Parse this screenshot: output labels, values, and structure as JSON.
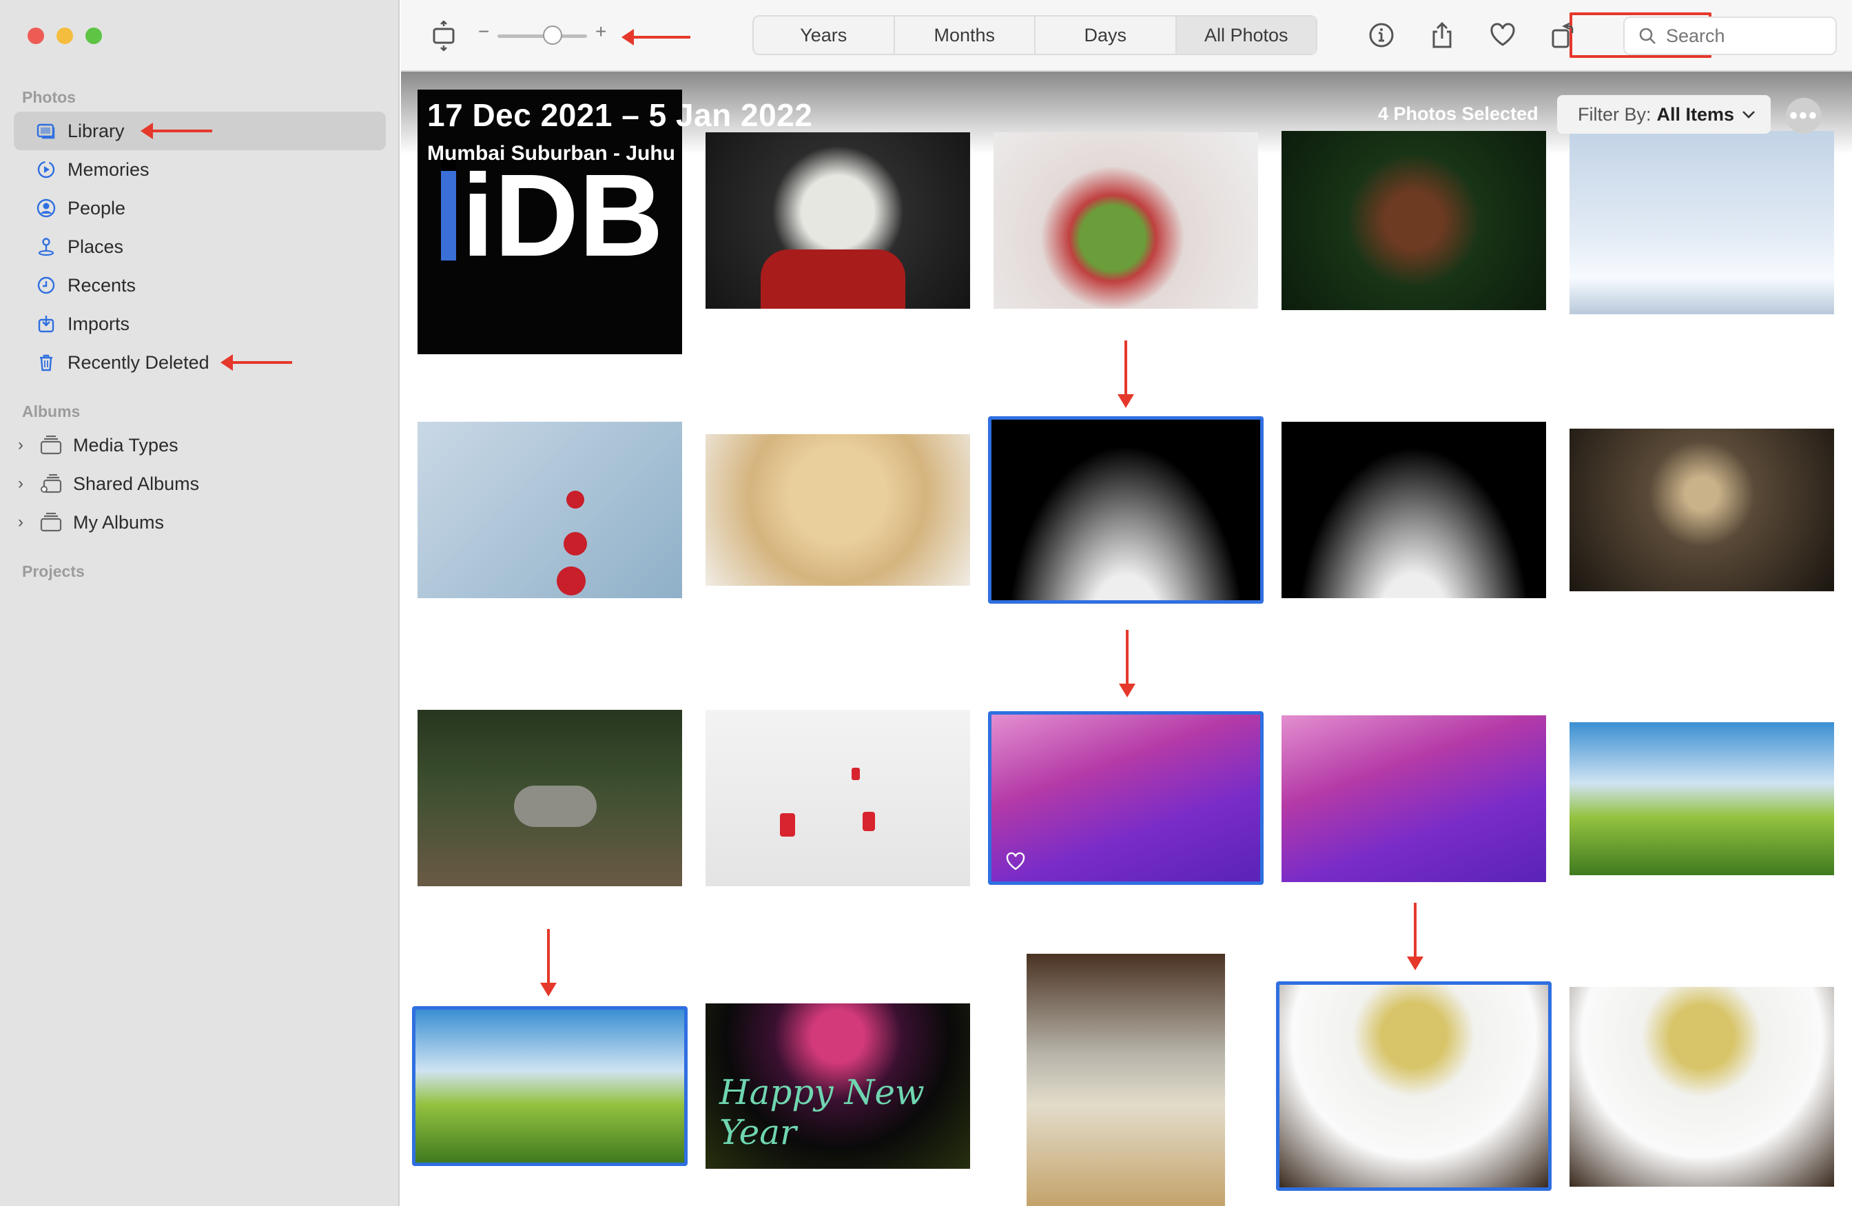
{
  "sidebar": {
    "photos_section": "Photos",
    "items": [
      {
        "label": "Library",
        "icon": "library-icon"
      },
      {
        "label": "Memories",
        "icon": "memories-icon"
      },
      {
        "label": "People",
        "icon": "people-icon"
      },
      {
        "label": "Places",
        "icon": "places-icon"
      },
      {
        "label": "Recents",
        "icon": "recents-icon"
      },
      {
        "label": "Imports",
        "icon": "imports-icon"
      },
      {
        "label": "Recently Deleted",
        "icon": "trash-icon"
      }
    ],
    "albums_section": "Albums",
    "albums": [
      {
        "label": "Media Types"
      },
      {
        "label": "Shared Albums"
      },
      {
        "label": "My Albums"
      }
    ],
    "projects_section": "Projects"
  },
  "toolbar": {
    "zoom_minus": "−",
    "zoom_plus": "+",
    "tabs": [
      "Years",
      "Months",
      "Days",
      "All Photos"
    ],
    "active_tab": "All Photos",
    "search_placeholder": "Search"
  },
  "main": {
    "date_range": "17 Dec 2021 – 5 Jan 2022",
    "location": "Mumbai Suburban - Juhu",
    "watermark": "iDB",
    "selected_count": "4 Photos Selected",
    "filter_label": "Filter By:",
    "filter_value": "All Items",
    "more_label": "•••",
    "photo_overlay_text": "Happy New Year"
  },
  "colors": {
    "accent": "#2f6fe0",
    "annotation": "#e5382b",
    "sidebar_bg": "#e3e3e3"
  }
}
